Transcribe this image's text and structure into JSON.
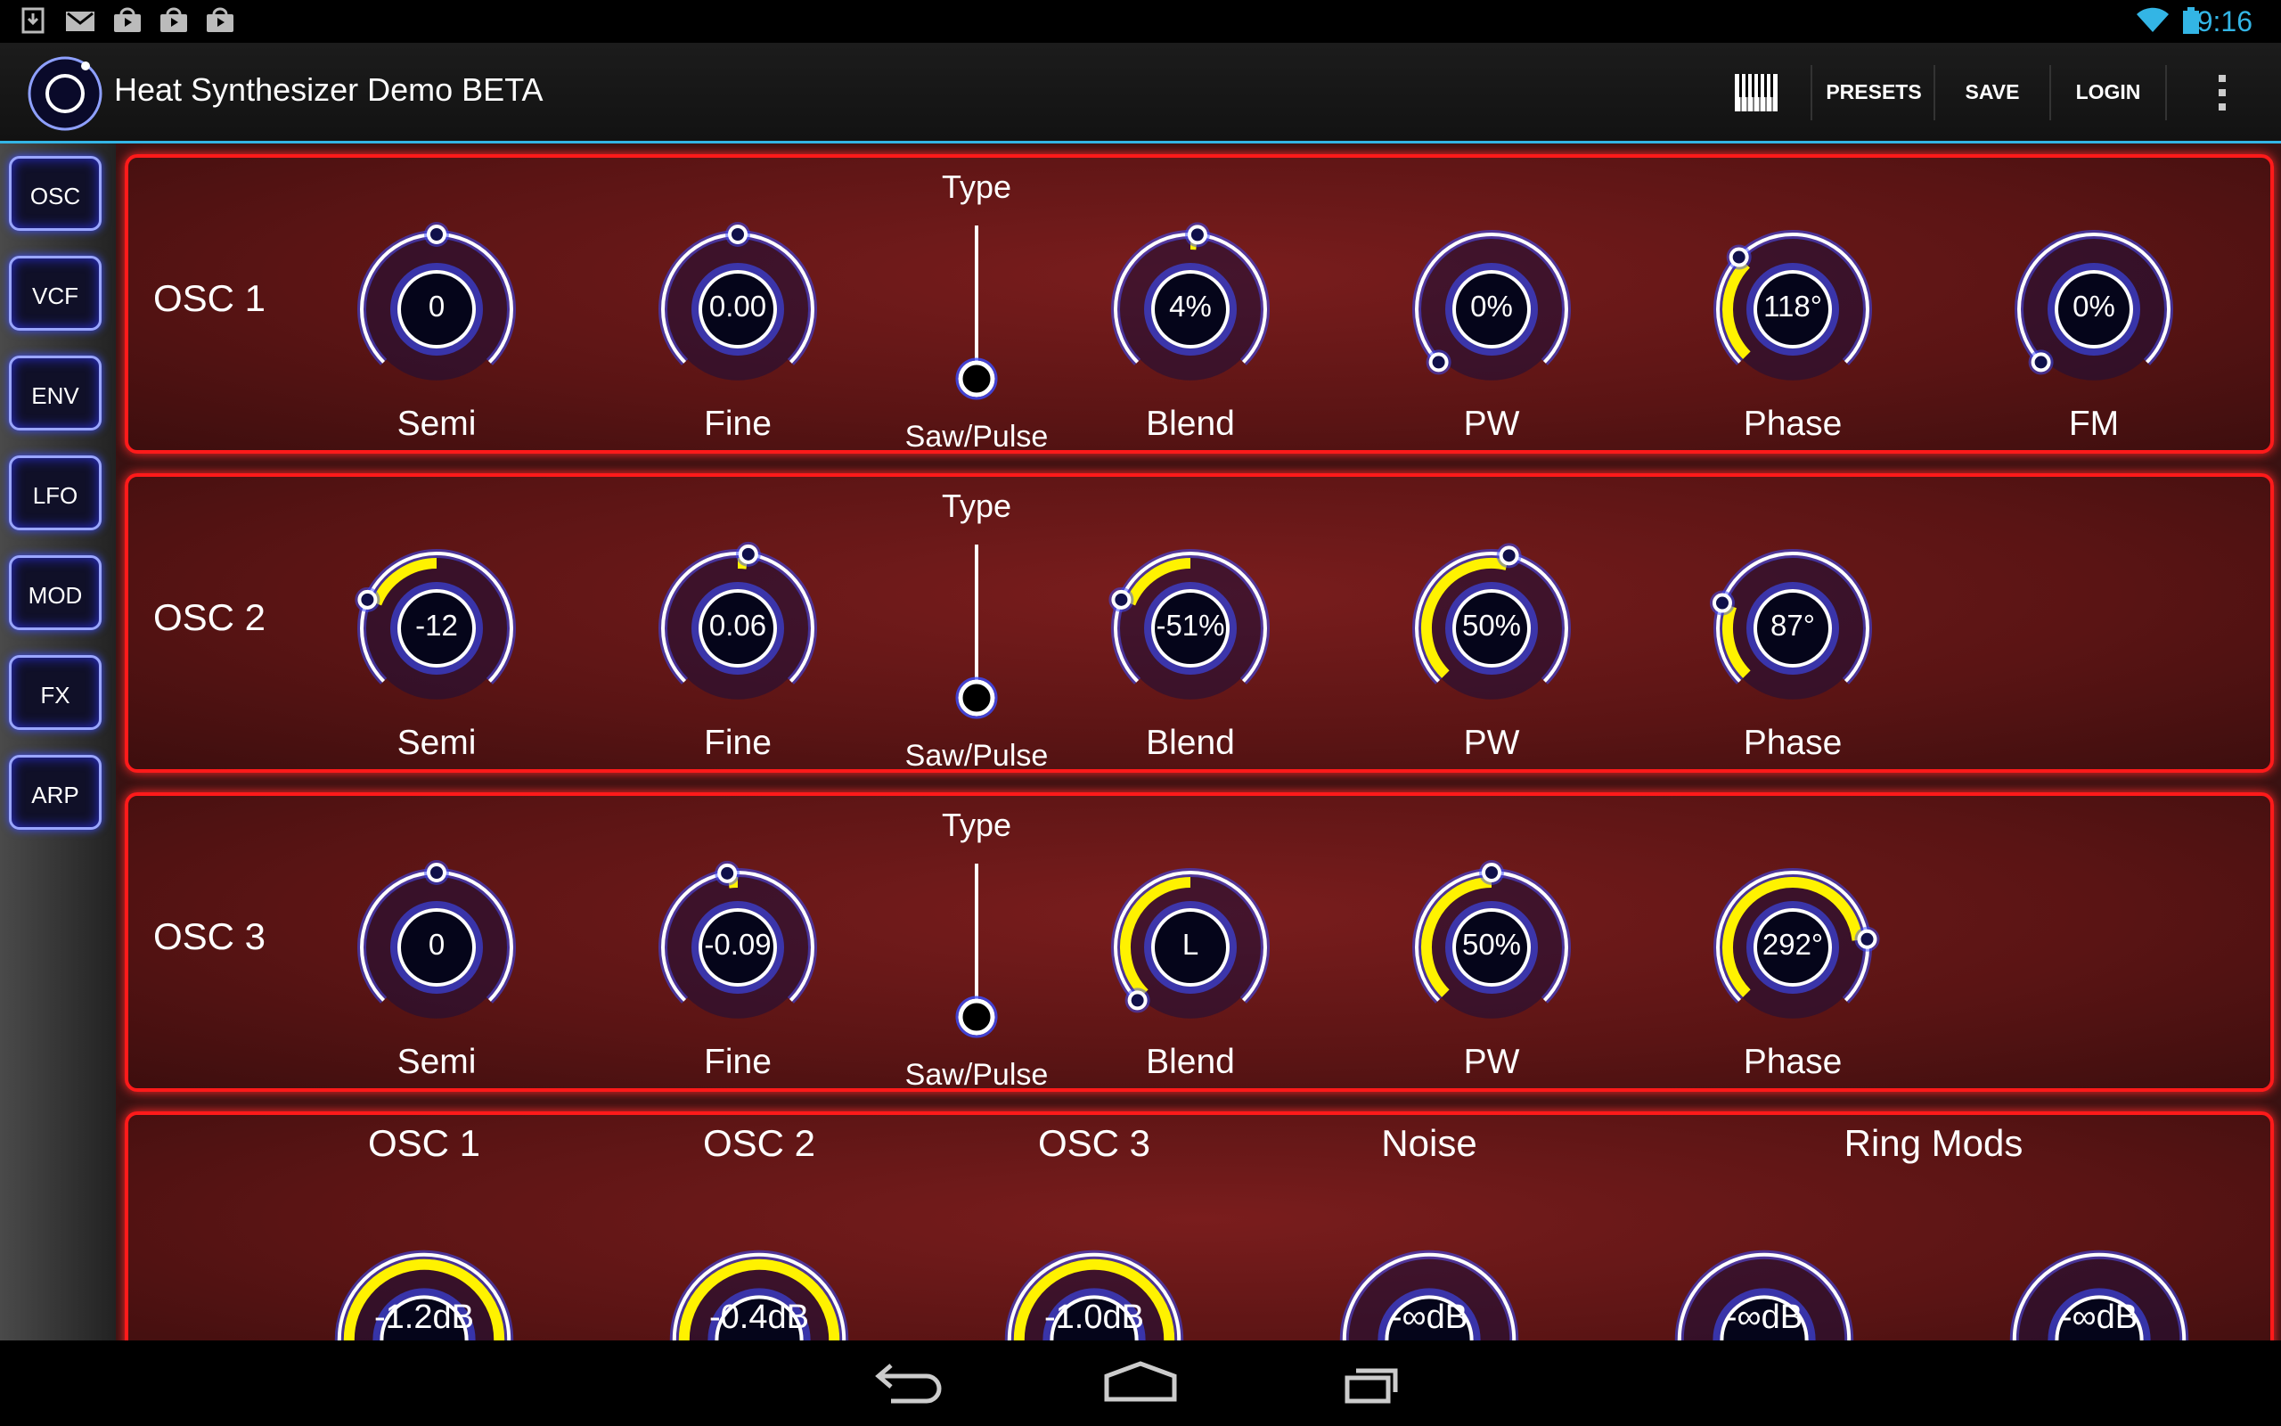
{
  "status_bar": {
    "left_icons": [
      "download-icon",
      "gmail-icon",
      "play-store-icon",
      "play-store-icon",
      "play-store-icon"
    ],
    "right_icons": [
      "wifi-icon",
      "battery-icon"
    ],
    "time": "9:16"
  },
  "action_bar": {
    "app_icon": "heat-logo-icon",
    "title": "Heat Synthesizer Demo BETA",
    "keyboard_icon": "piano-keys-icon",
    "presets": "PRESETS",
    "save": "SAVE",
    "login": "LOGIN",
    "overflow_icon": "more-vertical-icon"
  },
  "sidebar": {
    "items": [
      {
        "label": "OSC"
      },
      {
        "label": "VCF"
      },
      {
        "label": "ENV"
      },
      {
        "label": "LFO"
      },
      {
        "label": "MOD"
      },
      {
        "label": "FX"
      },
      {
        "label": "ARP"
      }
    ]
  },
  "colors": {
    "accent_blue": "#33b5e5",
    "knob_ring": "#ffffff",
    "knob_glow": "#3b4cff",
    "value_fill": "#fff200",
    "panel_border": "#ff1a1a",
    "panel_bg": "#5a1414"
  },
  "oscillators": [
    {
      "title": "OSC 1",
      "type": {
        "top": "Type",
        "bottom": "Saw/Pulse"
      },
      "knobs": [
        {
          "label": "Semi",
          "value": "0",
          "position": 0.5
        },
        {
          "label": "Fine",
          "value": "0.00",
          "position": 0.5
        },
        {
          "label": "Blend",
          "value": "4%",
          "position": 0.52
        },
        {
          "label": "PW",
          "value": "0%",
          "position": 0.0
        },
        {
          "label": "Phase",
          "value": "118°",
          "position": 0.33
        },
        {
          "label": "FM",
          "value": "0%",
          "position": 0.0
        }
      ]
    },
    {
      "title": "OSC 2",
      "type": {
        "top": "Type",
        "bottom": "Saw/Pulse"
      },
      "knobs": [
        {
          "label": "Semi",
          "value": "-12",
          "position": 0.25
        },
        {
          "label": "Fine",
          "value": "0.06",
          "position": 0.53
        },
        {
          "label": "Blend",
          "value": "-51%",
          "position": 0.25
        },
        {
          "label": "PW",
          "value": "50%",
          "position": 0.55
        },
        {
          "label": "Phase",
          "value": "87°",
          "position": 0.24
        }
      ]
    },
    {
      "title": "OSC 3",
      "type": {
        "top": "Type",
        "bottom": "Saw/Pulse"
      },
      "knobs": [
        {
          "label": "Semi",
          "value": "0",
          "position": 0.5
        },
        {
          "label": "Fine",
          "value": "-0.09",
          "position": 0.47
        },
        {
          "label": "Blend",
          "value": "L",
          "position": 0.0
        },
        {
          "label": "PW",
          "value": "50%",
          "position": 0.5
        },
        {
          "label": "Phase",
          "value": "292°",
          "position": 0.81
        }
      ]
    }
  ],
  "mixer": {
    "headers": [
      "OSC 1",
      "OSC 2",
      "OSC 3",
      "Noise",
      "Ring Mods"
    ],
    "knobs": [
      {
        "value": "-1.2dB",
        "position": 0.95
      },
      {
        "value": "-0.4dB",
        "position": 0.98
      },
      {
        "value": "-1.0dB",
        "position": 0.96
      },
      {
        "value": "-∞dB",
        "position": 0.0
      },
      {
        "value": "-∞dB",
        "position": 0.0
      },
      {
        "value": "-∞dB",
        "position": 0.0
      }
    ]
  },
  "nav_bar": {
    "back": "back-icon",
    "home": "home-icon",
    "recents": "recents-icon"
  }
}
